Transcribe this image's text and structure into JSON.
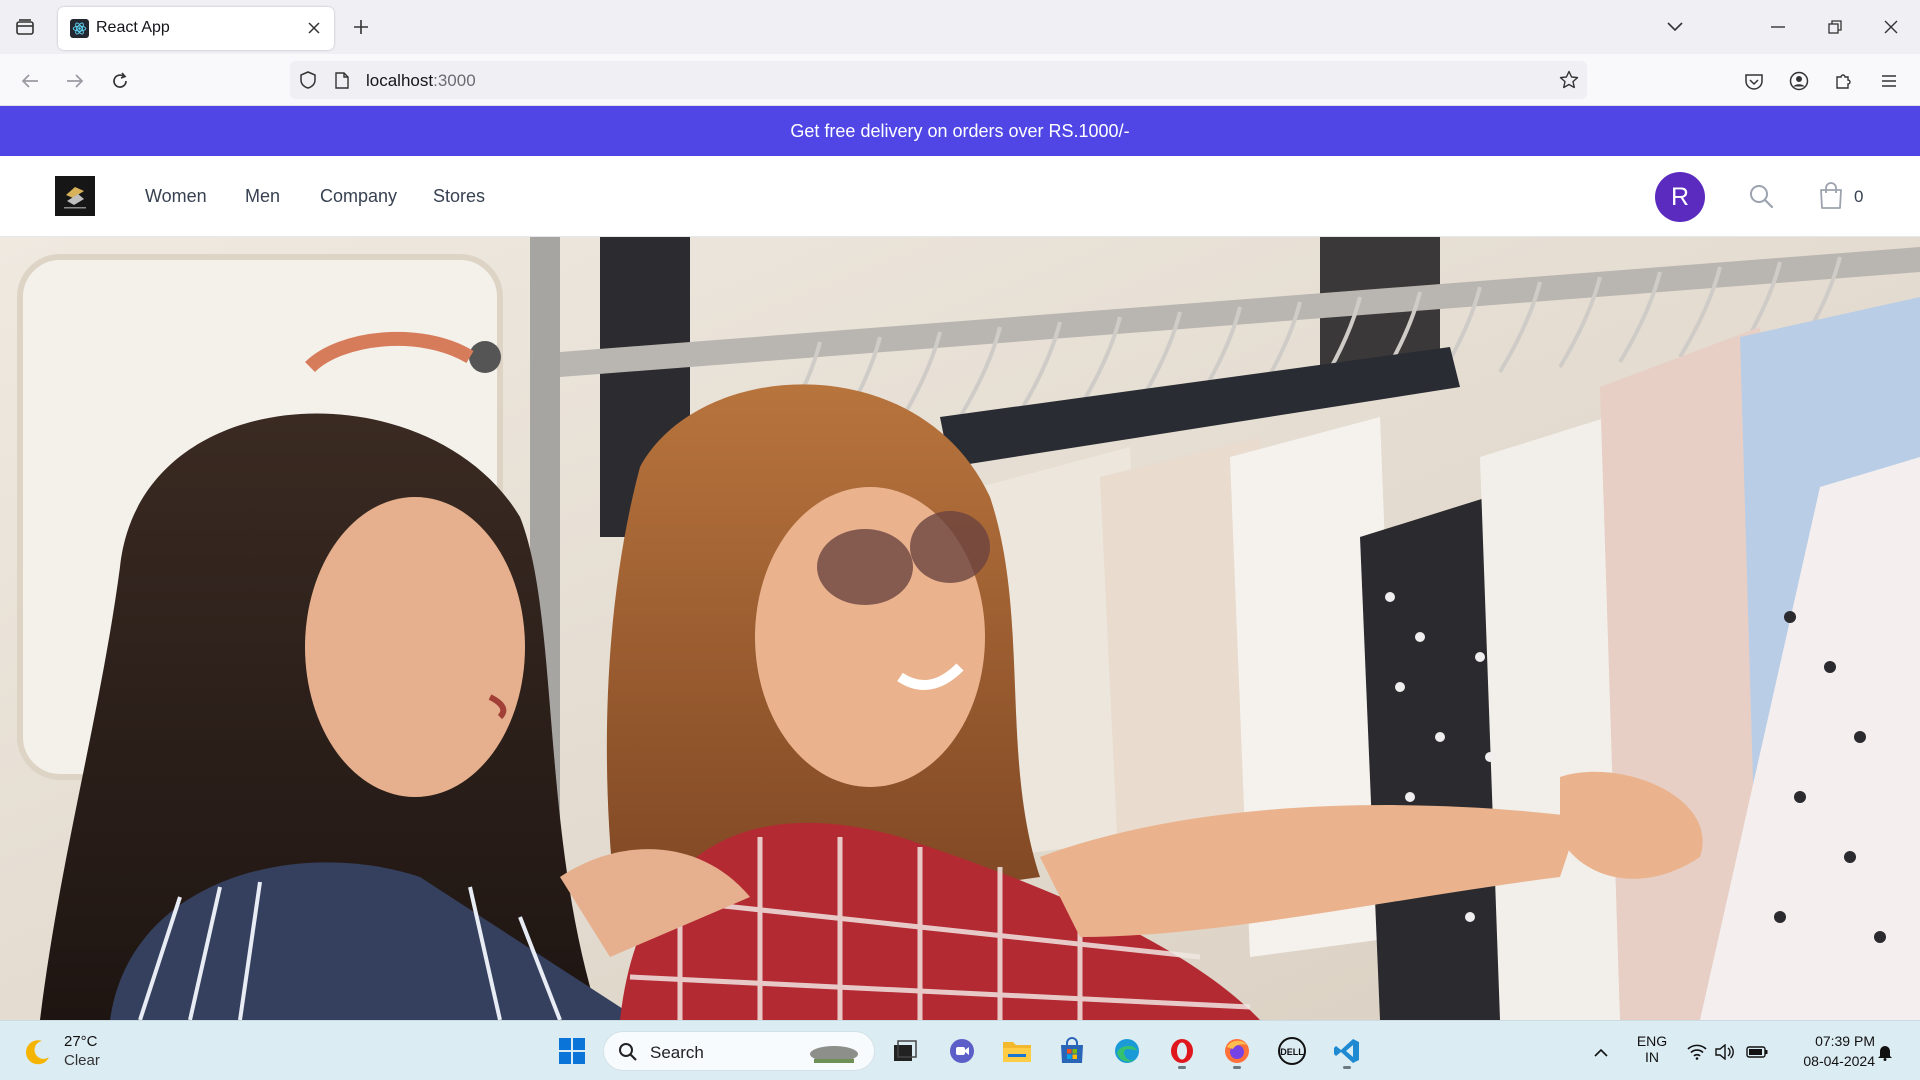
{
  "browser": {
    "tab_title": "React App",
    "url_host": "localhost",
    "url_port": ":3000"
  },
  "promo": {
    "text": "Get free delivery on orders over RS.1000/-"
  },
  "header": {
    "nav": [
      "Women",
      "Men",
      "Company",
      "Stores"
    ],
    "avatar_initial": "R",
    "cart_count": "0",
    "accent_color": "#4f46e5",
    "avatar_color": "#5b2bbf"
  },
  "hero": {
    "alt": "Two women browsing clothes on a rack"
  },
  "taskbar": {
    "weather_temp": "27°C",
    "weather_condition": "Clear",
    "search_label": "Search",
    "language_line1": "ENG",
    "language_line2": "IN",
    "time": "07:39 PM",
    "date": "08-04-2024",
    "apps": [
      "windows-start-icon",
      "task-view-icon",
      "meet-icon",
      "file-explorer-icon",
      "microsoft-store-icon",
      "edge-icon",
      "opera-icon",
      "firefox-icon",
      "dell-icon",
      "vscode-icon"
    ]
  }
}
